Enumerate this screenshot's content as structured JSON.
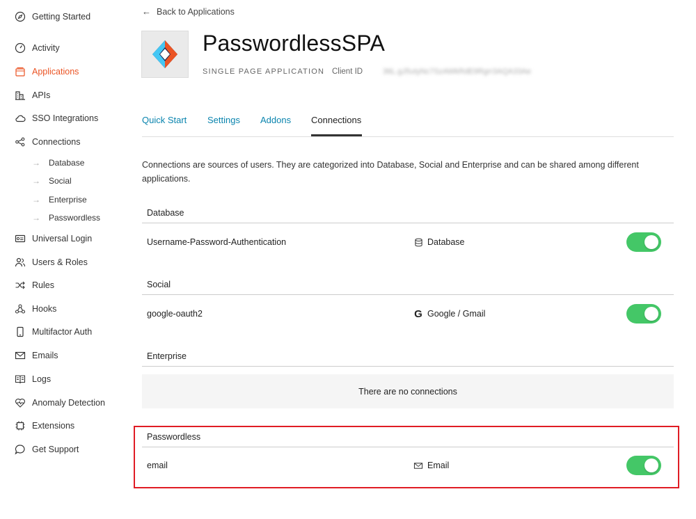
{
  "sidebar": {
    "items": [
      {
        "label": "Getting Started",
        "icon": "compass-icon"
      },
      {
        "label": "Activity",
        "icon": "gauge-icon"
      },
      {
        "label": "Applications",
        "icon": "applications-icon",
        "active": true
      },
      {
        "label": "APIs",
        "icon": "apis-icon"
      },
      {
        "label": "SSO Integrations",
        "icon": "cloud-icon"
      },
      {
        "label": "Connections",
        "icon": "share-nodes-icon"
      },
      {
        "label": "Universal Login",
        "icon": "login-card-icon"
      },
      {
        "label": "Users & Roles",
        "icon": "users-icon"
      },
      {
        "label": "Rules",
        "icon": "shuffle-icon"
      },
      {
        "label": "Hooks",
        "icon": "hooks-icon"
      },
      {
        "label": "Multifactor Auth",
        "icon": "phone-icon"
      },
      {
        "label": "Emails",
        "icon": "mail-icon"
      },
      {
        "label": "Logs",
        "icon": "book-icon"
      },
      {
        "label": "Anomaly Detection",
        "icon": "heart-pulse-icon"
      },
      {
        "label": "Extensions",
        "icon": "chip-icon"
      },
      {
        "label": "Get Support",
        "icon": "chat-bubble-icon"
      }
    ],
    "connection_subitems": [
      "Database",
      "Social",
      "Enterprise",
      "Passwordless"
    ]
  },
  "header": {
    "back_label": "Back to Applications",
    "app_name": "PasswordlessSPA",
    "app_type": "SINGLE PAGE APPLICATION",
    "client_id_label": "Client ID",
    "client_id_value": "3ttL.gJ5utyNc7SzAWkRdE9Rgrr3AQA33Ae"
  },
  "tabs": [
    {
      "label": "Quick Start"
    },
    {
      "label": "Settings"
    },
    {
      "label": "Addons"
    },
    {
      "label": "Connections",
      "active": true
    }
  ],
  "description": "Connections are sources of users. They are categorized into Database, Social and Enterprise and can be shared among different applications.",
  "sections": {
    "database": {
      "title": "Database",
      "rows": [
        {
          "name": "Username-Password-Authentication",
          "type": "Database",
          "enabled": true
        }
      ]
    },
    "social": {
      "title": "Social",
      "rows": [
        {
          "name": "google-oauth2",
          "type": "Google / Gmail",
          "enabled": true
        }
      ]
    },
    "enterprise": {
      "title": "Enterprise",
      "empty_text": "There are no connections"
    },
    "passwordless": {
      "title": "Passwordless",
      "rows": [
        {
          "name": "email",
          "type": "Email",
          "enabled": true
        }
      ]
    }
  },
  "colors": {
    "accent": "#eb5424",
    "link": "#0a84ae",
    "toggle_on": "#44c767",
    "highlight": "#e01c24"
  }
}
